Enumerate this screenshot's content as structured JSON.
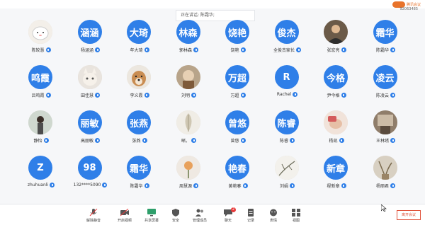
{
  "meeting": {
    "recording_text": "正在讲话: 陈霜华;",
    "logo_text": "腾讯会议",
    "meeting_id": "92063485"
  },
  "participants": [
    {
      "name": "陈皎慧",
      "avatar_text": "",
      "avatar": "photo-cartoon"
    },
    {
      "name": "杨涵涵",
      "avatar_text": "涵涵",
      "avatar": "text"
    },
    {
      "name": "年大琦",
      "avatar_text": "大琦",
      "avatar": "text"
    },
    {
      "name": "郭林森",
      "avatar_text": "林森",
      "avatar": "text"
    },
    {
      "name": "饶艳",
      "avatar_text": "饶艳",
      "avatar": "text"
    },
    {
      "name": "全俊杰家长",
      "avatar_text": "俊杰",
      "avatar": "text"
    },
    {
      "name": "张宏亮",
      "avatar_text": "",
      "avatar": "photo-man"
    },
    {
      "name": "陈霜华",
      "avatar_text": "霜华",
      "avatar": "text"
    },
    {
      "name": "吕鸣霞",
      "avatar_text": "鸣霞",
      "avatar": "text"
    },
    {
      "name": "田佳慧",
      "avatar_text": "",
      "avatar": "photo-cat"
    },
    {
      "name": "李义霞",
      "avatar_text": "",
      "avatar": "photo-dog"
    },
    {
      "name": "刘明",
      "avatar_text": "",
      "avatar": "photo-doll"
    },
    {
      "name": "万超",
      "avatar_text": "万超",
      "avatar": "text"
    },
    {
      "name": "Rachel",
      "avatar_text": "R",
      "avatar": "text"
    },
    {
      "name": "尹今格",
      "avatar_text": "今格",
      "avatar": "text"
    },
    {
      "name": "陈凌云",
      "avatar_text": "凌云",
      "avatar": "text"
    },
    {
      "name": "静怡",
      "avatar_text": "",
      "avatar": "photo-girl"
    },
    {
      "name": "高丽敏",
      "avatar_text": "丽敏",
      "avatar": "text"
    },
    {
      "name": "张燕",
      "avatar_text": "张燕",
      "avatar": "text"
    },
    {
      "name": "晰。",
      "avatar_text": "",
      "avatar": "photo-leaf"
    },
    {
      "name": "曾悠",
      "avatar_text": "曾悠",
      "avatar": "text"
    },
    {
      "name": "陈睿",
      "avatar_text": "陈睿",
      "avatar": "text"
    },
    {
      "name": "杨凯",
      "avatar_text": "",
      "avatar": "photo-hand"
    },
    {
      "name": "王林绣",
      "avatar_text": "",
      "avatar": "photo-room"
    },
    {
      "name": "zhuhuanli",
      "avatar_text": "Z",
      "avatar": "text"
    },
    {
      "name": "132****5090",
      "avatar_text": "98",
      "avatar": "text"
    },
    {
      "name": "陈霜华",
      "avatar_text": "霜华",
      "avatar": "text"
    },
    {
      "name": "周慧源",
      "avatar_text": "",
      "avatar": "photo-flower"
    },
    {
      "name": "黄艳春",
      "avatar_text": "艳春",
      "avatar": "text"
    },
    {
      "name": "刘娟",
      "avatar_text": "",
      "avatar": "photo-branch"
    },
    {
      "name": "程新章",
      "avatar_text": "新章",
      "avatar": "text"
    },
    {
      "name": "杨丽君",
      "avatar_text": "",
      "avatar": "photo-plant"
    }
  ],
  "toolbar": {
    "mute": "解除静音",
    "video": "开启视频",
    "share": "共享屏幕",
    "security": "安全",
    "members": "管理成员",
    "chat": "聊天",
    "chat_badge": "2",
    "record": "记录",
    "apps": "应用",
    "reaction": "表情",
    "view": "视图",
    "end": "离开会议"
  },
  "colors": {
    "avatar_blue": "#2f7fe8",
    "end_red": "#e0523a",
    "badge_red": "#e83b3b"
  }
}
